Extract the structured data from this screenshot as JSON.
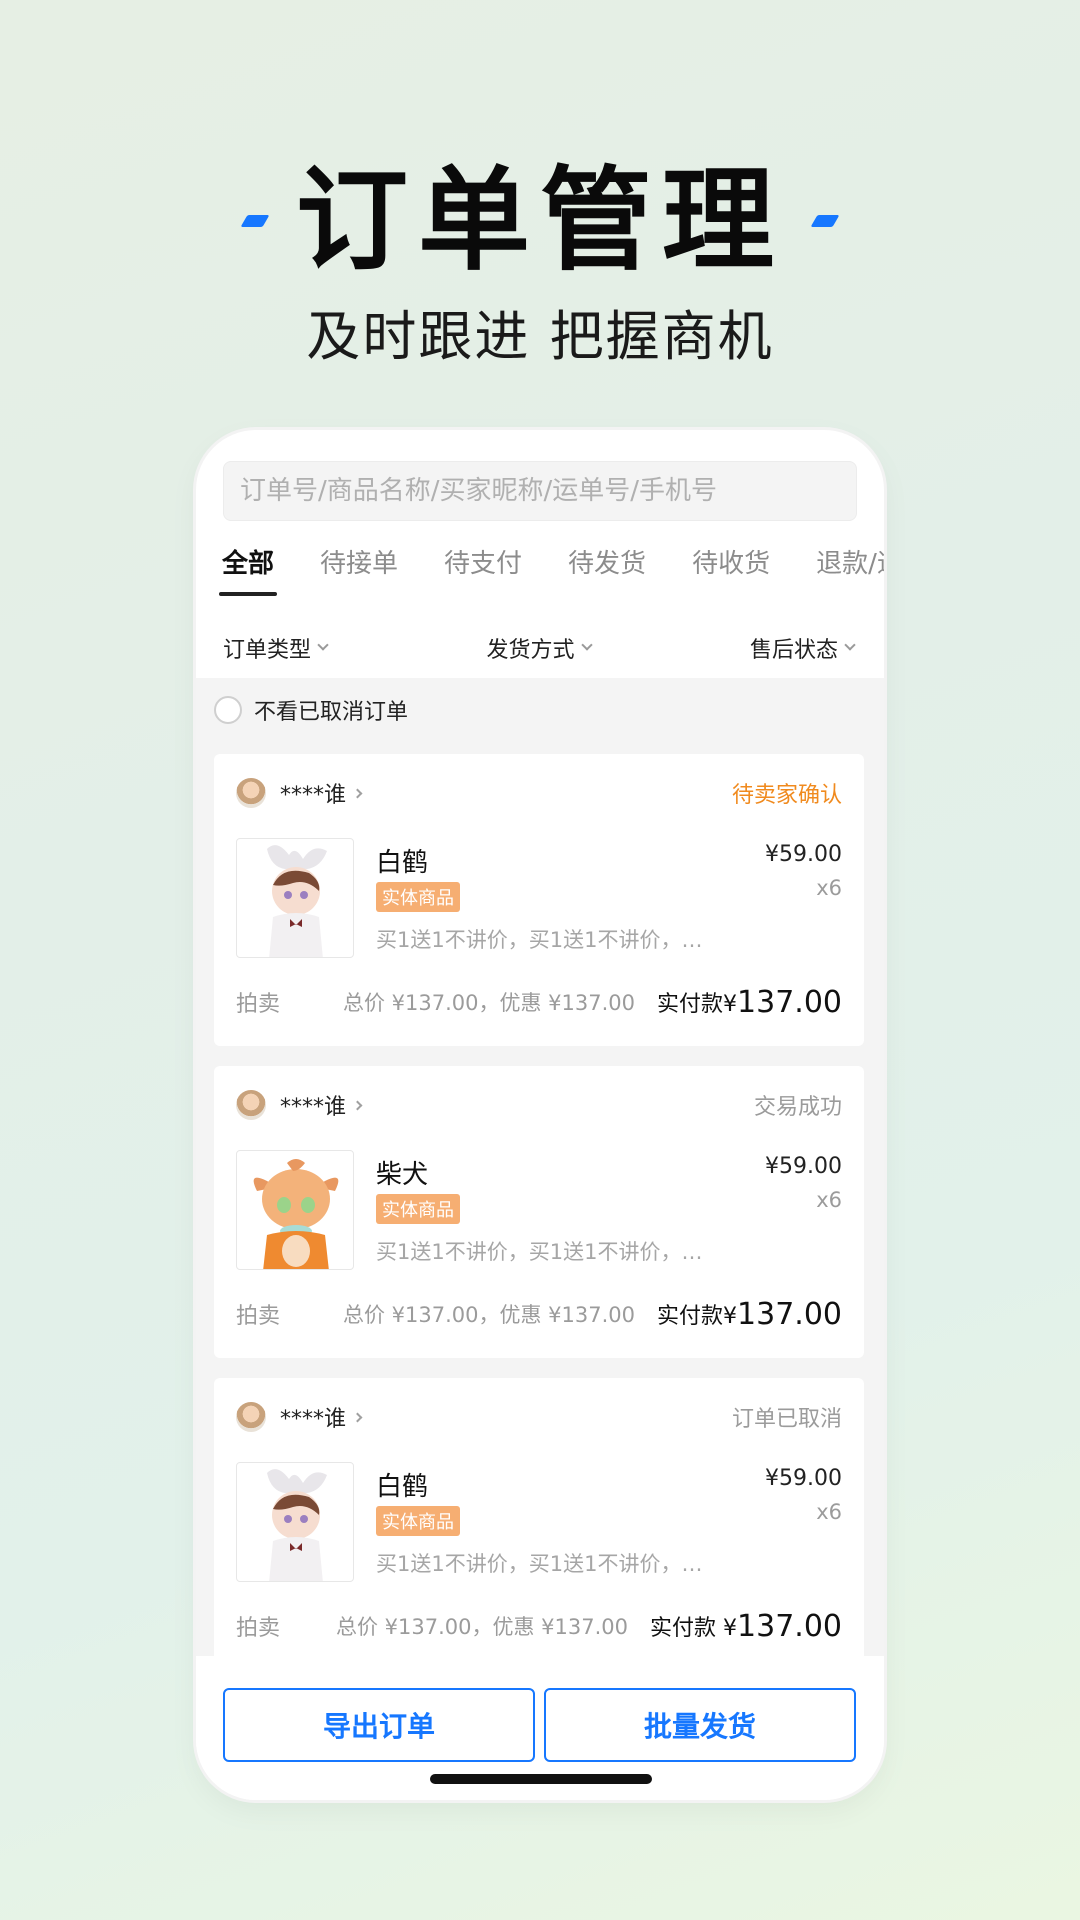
{
  "hero": {
    "title": "订单管理",
    "subtitle": "及时跟进 把握商机"
  },
  "search": {
    "placeholder": "订单号/商品名称/买家昵称/运单号/手机号"
  },
  "tabs": [
    "全部",
    "待接单",
    "待支付",
    "待发货",
    "待收货",
    "退款/退"
  ],
  "filters": {
    "order_type": "订单类型",
    "shipping": "发货方式",
    "after_sale": "售后状态"
  },
  "hide_cancelled": "不看已取消订单",
  "orders": [
    {
      "buyer": "****谁",
      "status": "待卖家确认",
      "product": "白鹤",
      "tag": "实体商品",
      "desc": "买1送1不讲价，买1送1不讲价，…",
      "price": "¥59.00",
      "qty": "x6",
      "sale_type": "拍卖",
      "summary": "总价 ¥137.00，优惠 ¥137.00",
      "paid_label": "实付款¥",
      "paid_amount": "137.00"
    },
    {
      "buyer": "****谁",
      "status": "交易成功",
      "product": "柴犬",
      "tag": "实体商品",
      "desc": "买1送1不讲价，买1送1不讲价，…",
      "price": "¥59.00",
      "qty": "x6",
      "sale_type": "拍卖",
      "summary": "总价 ¥137.00，优惠 ¥137.00",
      "paid_label": "实付款¥",
      "paid_amount": "137.00"
    },
    {
      "buyer": "****谁",
      "status": "订单已取消",
      "product": "白鹤",
      "tag": "实体商品",
      "desc": "买1送1不讲价，买1送1不讲价，…",
      "price": "¥59.00",
      "qty": "x6",
      "sale_type": "拍卖",
      "summary": "总价 ¥137.00，优惠 ¥137.00",
      "paid_label": "实付款 ¥",
      "paid_amount": "137.00"
    }
  ],
  "actions": {
    "export": "导出订单",
    "batch_ship": "批量发货"
  },
  "colors": {
    "accent": "#1677ff",
    "pending": "#f08a1e",
    "tag": "#f5a05a"
  }
}
